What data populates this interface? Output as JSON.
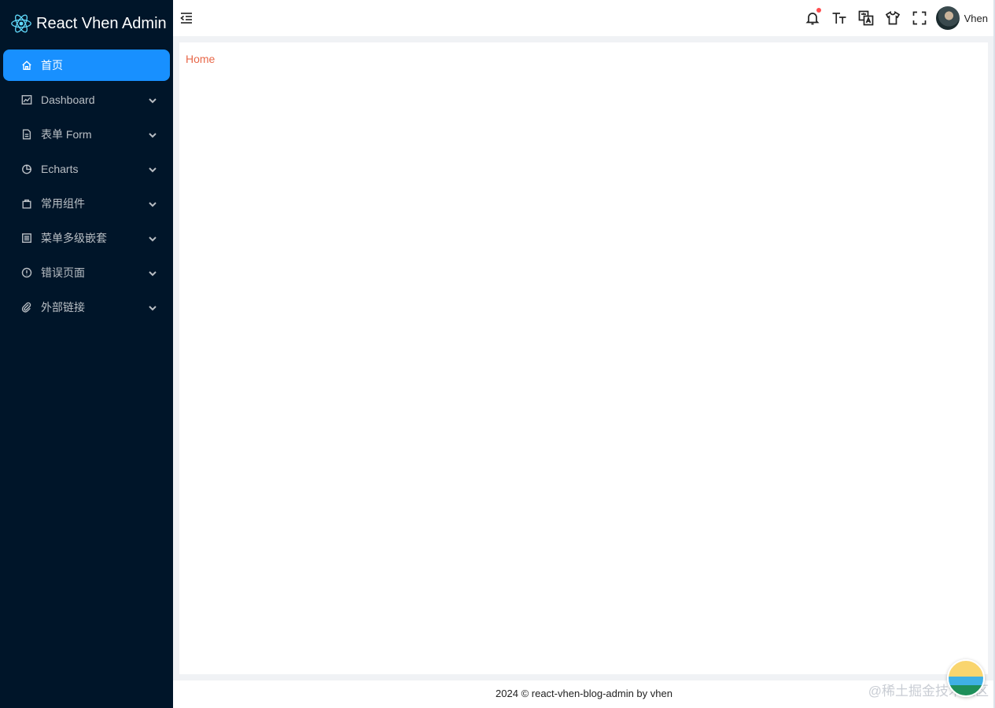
{
  "app": {
    "title": "React Vhen Admin",
    "brand_color": "#61dafb"
  },
  "colors": {
    "sidebar_bg": "#001529",
    "active_bg": "#1890ff",
    "breadcrumb": "#e8684a",
    "badge": "#ff4d4f"
  },
  "sidebar": {
    "items": [
      {
        "label": "首页",
        "icon": "home-icon",
        "active": true,
        "expandable": false
      },
      {
        "label": "Dashboard",
        "icon": "line-chart-icon",
        "active": false,
        "expandable": true
      },
      {
        "label": "表单 Form",
        "icon": "file-icon",
        "active": false,
        "expandable": true
      },
      {
        "label": "Echarts",
        "icon": "pie-chart-icon",
        "active": false,
        "expandable": true
      },
      {
        "label": "常用组件",
        "icon": "shopping-bag-icon",
        "active": false,
        "expandable": true
      },
      {
        "label": "菜单多级嵌套",
        "icon": "list-icon",
        "active": false,
        "expandable": true
      },
      {
        "label": "错误页面",
        "icon": "exclamation-circle-icon",
        "active": false,
        "expandable": true
      },
      {
        "label": "外部链接",
        "icon": "paperclip-icon",
        "active": false,
        "expandable": true
      }
    ]
  },
  "header": {
    "tools": [
      "collapse-icon",
      "bell-icon",
      "font-size-icon",
      "translate-icon",
      "theme-shirt-icon",
      "fullscreen-icon"
    ],
    "username": "Vhen"
  },
  "breadcrumb": {
    "current": "Home"
  },
  "footer": {
    "text": "2024 © react-vhen-blog-admin by vhen"
  },
  "watermark": {
    "text": "@稀土掘金技术社区"
  }
}
